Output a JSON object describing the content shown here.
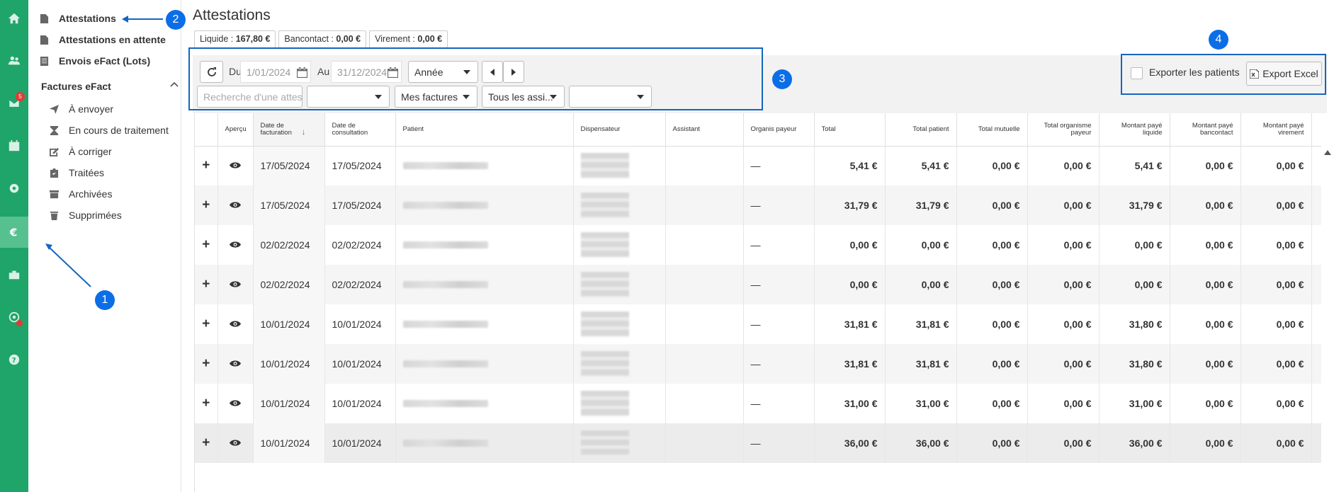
{
  "rail": {
    "items": [
      {
        "icon": "home-icon"
      },
      {
        "icon": "users-icon"
      },
      {
        "icon": "mail-icon",
        "badge": "5"
      },
      {
        "icon": "calendar-icon"
      },
      {
        "icon": "gear-icon"
      },
      {
        "icon": "euro-icon",
        "active": true
      },
      {
        "icon": "briefcase-icon"
      },
      {
        "icon": "radar-icon"
      },
      {
        "icon": "help-icon"
      }
    ],
    "accent": "#1fa46a"
  },
  "sidenav": {
    "top_items": [
      {
        "label": "Attestations",
        "icon": "document-icon"
      },
      {
        "label": "Attestations en attente",
        "icon": "document-icon"
      },
      {
        "label": "Envois eFact (Lots)",
        "icon": "list-icon"
      }
    ],
    "section_title": "Factures eFact",
    "sub_items": [
      {
        "label": "À envoyer",
        "icon": "send-icon"
      },
      {
        "label": "En cours de traitement",
        "icon": "hourglass-icon"
      },
      {
        "label": "À corriger",
        "icon": "edit-icon"
      },
      {
        "label": "Traitées",
        "icon": "clipboard-check-icon"
      },
      {
        "label": "Archivées",
        "icon": "archive-icon"
      },
      {
        "label": "Supprimées",
        "icon": "trash-icon"
      }
    ]
  },
  "page": {
    "title": "Attestations",
    "totals": [
      {
        "label": "Liquide : ",
        "value": "167,80 €"
      },
      {
        "label": "Bancontact : ",
        "value": "0,00 €"
      },
      {
        "label": "Virement : ",
        "value": "0,00 €"
      }
    ]
  },
  "filters": {
    "from_label": "Du",
    "from_value": "1/01/2024",
    "to_label": "Au",
    "to_value": "31/12/2024",
    "period_select": "Année",
    "search_placeholder": "Recherche d'une attestation",
    "select_empty1": "",
    "invoices_select": "Mes factures",
    "assistants_select": "Tous les assi...",
    "select_empty2": ""
  },
  "export": {
    "checkbox_label": "Exporter les patients",
    "button_label": "Export Excel"
  },
  "annotations": [
    "1",
    "2",
    "3",
    "4"
  ],
  "table": {
    "headers": {
      "apercu": "Aperçu",
      "date_facturation": "Date de facturation",
      "date_consultation": "Date de consultation",
      "patient": "Patient",
      "dispensateur": "Dispensateur",
      "assistant": "Assistant",
      "organis_payeur": "Organis payeur",
      "total": "Total",
      "total_patient": "Total patient",
      "total_mutuelle": "Total mutuelle",
      "total_org": "Total organisme payeur",
      "paye_liquide": "Montant payé liquide",
      "paye_bancontact": "Montant payé bancontact",
      "paye_virement": "Montant payé virement"
    },
    "rows": [
      {
        "plus": "+",
        "date_fact": "17/05/2024",
        "date_cons": "17/05/2024",
        "org": "—",
        "total": "5,41 €",
        "patient": "5,41 €",
        "mutuelle": "0,00 €",
        "org_total": "0,00 €",
        "liquide": "5,41 €",
        "bancontact": "0,00 €",
        "virement": "0,00 €"
      },
      {
        "plus": "+",
        "date_fact": "17/05/2024",
        "date_cons": "17/05/2024",
        "org": "—",
        "total": "31,79 €",
        "patient": "31,79 €",
        "mutuelle": "0,00 €",
        "org_total": "0,00 €",
        "liquide": "31,79 €",
        "bancontact": "0,00 €",
        "virement": "0,00 €"
      },
      {
        "plus": "+",
        "date_fact": "02/02/2024",
        "date_cons": "02/02/2024",
        "org": "—",
        "total": "0,00 €",
        "patient": "0,00 €",
        "mutuelle": "0,00 €",
        "org_total": "0,00 €",
        "liquide": "0,00 €",
        "bancontact": "0,00 €",
        "virement": "0,00 €"
      },
      {
        "plus": "+",
        "date_fact": "02/02/2024",
        "date_cons": "02/02/2024",
        "org": "—",
        "total": "0,00 €",
        "patient": "0,00 €",
        "mutuelle": "0,00 €",
        "org_total": "0,00 €",
        "liquide": "0,00 €",
        "bancontact": "0,00 €",
        "virement": "0,00 €"
      },
      {
        "plus": "+",
        "date_fact": "10/01/2024",
        "date_cons": "10/01/2024",
        "org": "—",
        "total": "31,81 €",
        "patient": "31,81 €",
        "mutuelle": "0,00 €",
        "org_total": "0,00 €",
        "liquide": "31,80 €",
        "bancontact": "0,00 €",
        "virement": "0,00 €"
      },
      {
        "plus": "+",
        "date_fact": "10/01/2024",
        "date_cons": "10/01/2024",
        "org": "—",
        "total": "31,81 €",
        "patient": "31,81 €",
        "mutuelle": "0,00 €",
        "org_total": "0,00 €",
        "liquide": "31,80 €",
        "bancontact": "0,00 €",
        "virement": "0,00 €"
      },
      {
        "plus": "+",
        "date_fact": "10/01/2024",
        "date_cons": "10/01/2024",
        "org": "—",
        "total": "31,00 €",
        "patient": "31,00 €",
        "mutuelle": "0,00 €",
        "org_total": "0,00 €",
        "liquide": "31,00 €",
        "bancontact": "0,00 €",
        "virement": "0,00 €"
      },
      {
        "plus": "+",
        "date_fact": "10/01/2024",
        "date_cons": "10/01/2024",
        "org": "—",
        "total": "36,00 €",
        "patient": "36,00 €",
        "mutuelle": "0,00 €",
        "org_total": "0,00 €",
        "liquide": "36,00 €",
        "bancontact": "0,00 €",
        "virement": "0,00 €"
      }
    ]
  }
}
